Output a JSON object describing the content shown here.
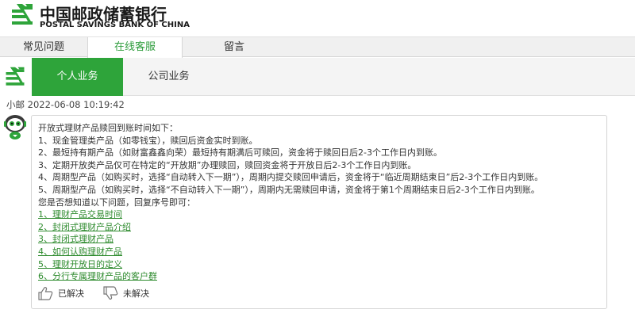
{
  "brand": {
    "name_cn": "中国邮政储蓄银行",
    "name_en": "POSTAL SAVINGS BANK OF CHINA",
    "color": "#2ea43a",
    "logo_icon": "psbc-logo-icon"
  },
  "top_tabs": [
    {
      "label": "常见问题",
      "active": false
    },
    {
      "label": "在线客服",
      "active": true
    },
    {
      "label": "留言",
      "active": false
    }
  ],
  "business_tabs": [
    {
      "label": "个人业务",
      "active": true
    },
    {
      "label": "公司业务",
      "active": false
    }
  ],
  "message": {
    "sender": "小邮",
    "timestamp": "2022-06-08 10:19:42",
    "avatar_icon": "robot-avatar-icon",
    "lines": [
      "开放式理财产品赎回到账时间如下：",
      "1、现金管理类产品（如零钱宝），赎回后资金实时到账。",
      "2、最短持有期产品（如财富鑫鑫向荣）最短持有期满后可赎回，资金将于赎回日后2-3个工作日内到账。",
      "3、定期开放类产品仅可在特定的“开放期”办理赎回，赎回资金将于开放日后2-3个工作日内到账。",
      "4、周期型产品（如购买时，选择“自动转入下一期”），周期内提交赎回申请后，资金将于“临近周期结束日”后2-3个工作日内到账。",
      "5、周期型产品（如购买时，选择“不自动转入下一期”），周期内无需赎回申请，资金将于第1个周期结束日后2-3个工作日内到账。",
      "您是否想知道以下问题，回复序号即可："
    ],
    "links": [
      "1、理财产品交易时间",
      "2、封闭式理财产品介绍",
      "3、封闭式理财产品",
      "4、如何认购理财产品",
      "5、理财开放日的定义",
      "6、分行专属理财产品的客户群"
    ],
    "feedback": {
      "solved_label": "已解决",
      "solved_icon": "thumbs-up-icon",
      "unsolved_label": "未解决",
      "unsolved_icon": "thumbs-down-icon"
    }
  }
}
